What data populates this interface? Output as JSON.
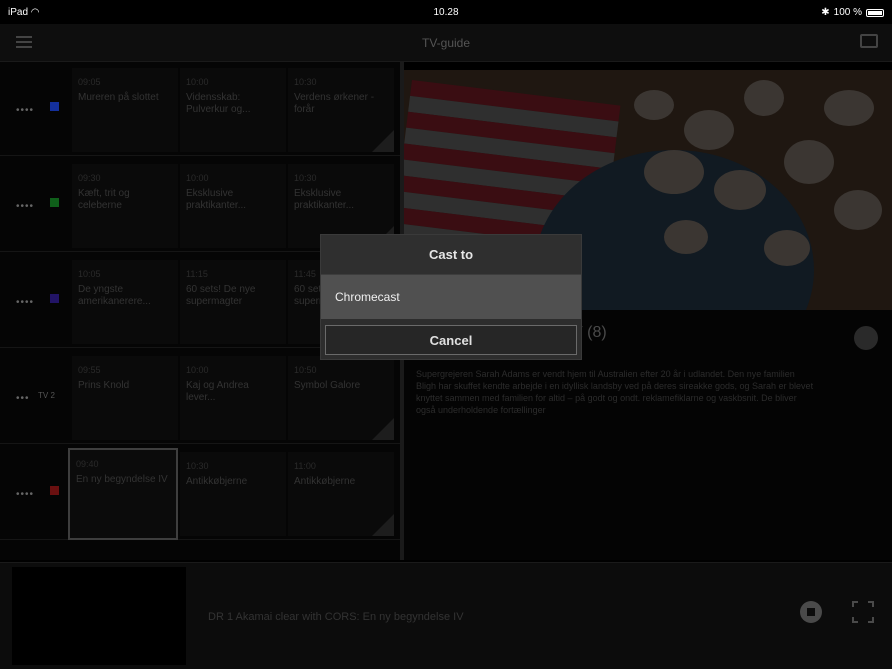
{
  "status_bar": {
    "device": "iPad",
    "wifi_icon": "wifi-icon",
    "time": "10.28",
    "bt_icon": "bluetooth-icon",
    "battery": "100 %"
  },
  "nav": {
    "title": "TV-guide",
    "menu_icon": "hamburger-icon",
    "cast_icon": "cast-icon"
  },
  "grid": {
    "rows": [
      {
        "logo_color": "#14309c",
        "programs": [
          {
            "time": "09:05",
            "title": "Mureren på slottet"
          },
          {
            "time": "10:00",
            "title": "Vidensskab: Pulverkur og..."
          },
          {
            "time": "10:30",
            "title": "Verdens ørkener - forår"
          }
        ]
      },
      {
        "logo_color": "#0f5f1a",
        "programs": [
          {
            "time": "09:30",
            "title": "Kæft, trit og celeberne"
          },
          {
            "time": "10:00",
            "title": "Eksklusive praktikanter..."
          },
          {
            "time": "10:30",
            "title": "Eksklusive praktikanter..."
          }
        ]
      },
      {
        "logo_color": "#221466",
        "programs": [
          {
            "time": "10:05",
            "title": "De yngste amerikanerere..."
          },
          {
            "time": "11:15",
            "title": "60 sets! De nye supermagter"
          },
          {
            "time": "11:45",
            "title": "60 sets! De nye supermagter"
          }
        ]
      },
      {
        "logo_text": "TV 2",
        "programs": [
          {
            "time": "09:55",
            "title": "Prins Knold"
          },
          {
            "time": "10:00",
            "title": "Kaj og Andrea lever..."
          },
          {
            "time": "10:50",
            "title": "Symbol Galore"
          }
        ]
      },
      {
        "logo_color": "#6a1010",
        "programs": [
          {
            "time": "09:40",
            "title": "En ny begyndelse IV"
          },
          {
            "time": "10:30",
            "title": "Antikkøbjerne"
          },
          {
            "time": "11:00",
            "title": "Antikkøbjerne"
          }
        ]
      }
    ]
  },
  "details": {
    "title": "V (8)",
    "description": "Supergrejeren Sarah Adams er vendt hjem til Australien efter 20 år i udlandet. Den nye familien Bligh har skuffet kendte arbejde i en idyllisk landsby ved på deres sireakke gods, og Sarah er blevet knyttet sammen med familien for altid – på godt og ondt. reklamefiklarne og vaskbsnit. De bliver også underholdende fortællinger"
  },
  "player": {
    "now_playing": "DR 1 Akamai clear with CORS: En ny begyndelse IV",
    "stop_icon": "stop-icon",
    "fullscreen_icon": "fullscreen-icon"
  },
  "dialog": {
    "title": "Cast to",
    "option": "Chromecast",
    "cancel": "Cancel"
  }
}
